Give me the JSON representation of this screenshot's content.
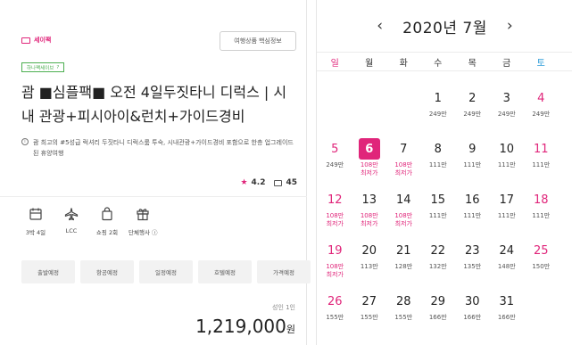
{
  "left": {
    "brand": "세이팩",
    "info_button": "여행상품 핵심정보",
    "tag": "하나팩세이브",
    "tag_info": "?",
    "title": "괌 ■심플팩■ 오전 4일두짓타니 디럭스 | 시내 관광+피시아이&런치+가이드경비",
    "desc": "괌 최고의 #5성급 럭셔리 두짓타니 디럭스룸 투숙, 시내관광+가이드경비 포함으로 한층 업그레이드 된 휴양여행",
    "rating": "4.2",
    "reviews": "45",
    "features": [
      {
        "icon": "calendar-icon",
        "label": "3박 4일"
      },
      {
        "icon": "airplane-icon",
        "label": "LCC"
      },
      {
        "icon": "shopping-bag-icon",
        "label": "쇼핑 2회"
      },
      {
        "icon": "gift-icon",
        "label": "단체행사 ⓘ"
      }
    ],
    "tabs": [
      "출발예정",
      "항공예정",
      "일정예정",
      "호텔예정",
      "가격예정"
    ],
    "price_label": "성인 1인",
    "price": "1,219,000",
    "price_unit": "원"
  },
  "calendar": {
    "prev": "‹",
    "next": "›",
    "month": "2020년 7월",
    "weekdays": [
      "일",
      "월",
      "화",
      "수",
      "목",
      "금",
      "토"
    ],
    "weeks": [
      [
        null,
        null,
        null,
        {
          "d": "1",
          "p": "249만"
        },
        {
          "d": "2",
          "p": "249만"
        },
        {
          "d": "3",
          "p": "249만"
        },
        {
          "d": "4",
          "p": "249만"
        }
      ],
      [
        {
          "d": "5",
          "p": "249만"
        },
        {
          "d": "6",
          "p": "108만",
          "min": "최저가",
          "sel": true
        },
        {
          "d": "7",
          "p": "108만",
          "min": "최저가"
        },
        {
          "d": "8",
          "p": "111만"
        },
        {
          "d": "9",
          "p": "111만"
        },
        {
          "d": "10",
          "p": "111만"
        },
        {
          "d": "11",
          "p": "111만"
        }
      ],
      [
        {
          "d": "12",
          "p": "108만",
          "min": "최저가"
        },
        {
          "d": "13",
          "p": "108만",
          "min": "최저가"
        },
        {
          "d": "14",
          "p": "108만",
          "min": "최저가"
        },
        {
          "d": "15",
          "p": "111만"
        },
        {
          "d": "16",
          "p": "111만"
        },
        {
          "d": "17",
          "p": "111만"
        },
        {
          "d": "18",
          "p": "111만"
        }
      ],
      [
        {
          "d": "19",
          "p": "108만",
          "min": "최저가"
        },
        {
          "d": "20",
          "p": "113만"
        },
        {
          "d": "21",
          "p": "128만"
        },
        {
          "d": "22",
          "p": "132만"
        },
        {
          "d": "23",
          "p": "135만"
        },
        {
          "d": "24",
          "p": "148만"
        },
        {
          "d": "25",
          "p": "150만"
        }
      ],
      [
        {
          "d": "26",
          "p": "155만"
        },
        {
          "d": "27",
          "p": "155만"
        },
        {
          "d": "28",
          "p": "155만"
        },
        {
          "d": "29",
          "p": "166만"
        },
        {
          "d": "30",
          "p": "166만"
        },
        {
          "d": "31",
          "p": "166만"
        },
        null
      ]
    ]
  },
  "colors": {
    "accent": "#e0257a",
    "saturday": "#2a9bd8",
    "tag_green": "#4caf50"
  }
}
